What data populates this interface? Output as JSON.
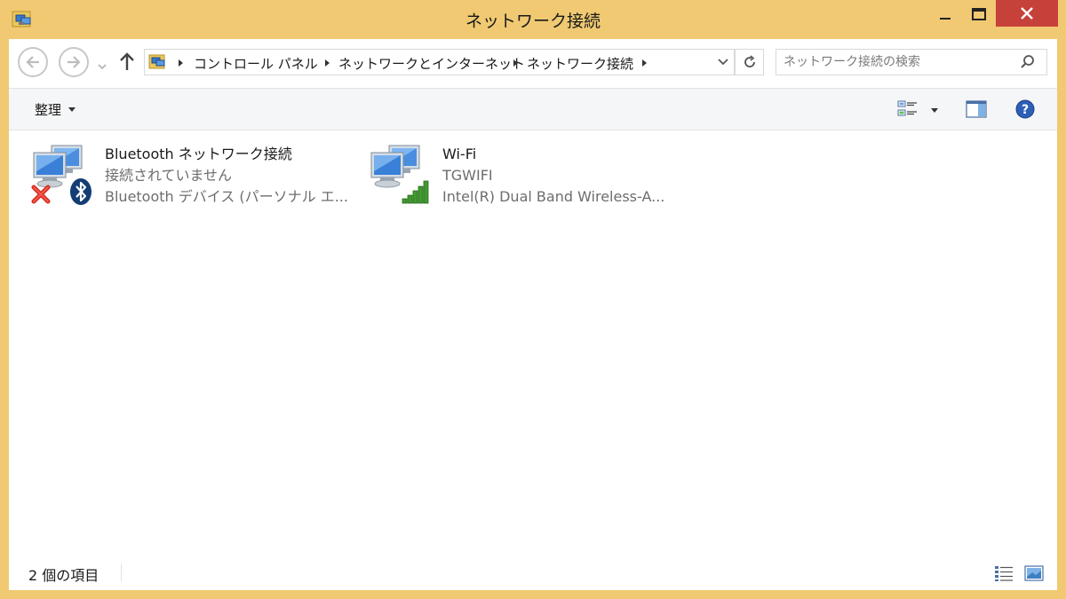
{
  "window": {
    "title": "ネットワーク接続",
    "frame_color": "#f0c972",
    "close_color": "#c7413b"
  },
  "address": {
    "crumbs": [
      "コントロール パネル",
      "ネットワークとインターネット",
      "ネットワーク接続"
    ]
  },
  "search": {
    "placeholder": "ネットワーク接続の検索"
  },
  "commandbar": {
    "organize_label": "整理"
  },
  "items": [
    {
      "name": "Bluetooth ネットワーク接続",
      "status": "接続されていません",
      "device": "Bluetooth デバイス (パーソナル エ...",
      "icon": "network-computers-icon",
      "overlay_icons": [
        "red-x-icon",
        "bluetooth-icon"
      ]
    },
    {
      "name": "Wi-Fi",
      "status": "TGWIFI",
      "device": "Intel(R) Dual Band Wireless-A...",
      "icon": "network-computers-icon",
      "overlay_icons": [
        "signal-bars-icon"
      ]
    }
  ],
  "statusbar": {
    "count_text": "2 個の項目"
  }
}
